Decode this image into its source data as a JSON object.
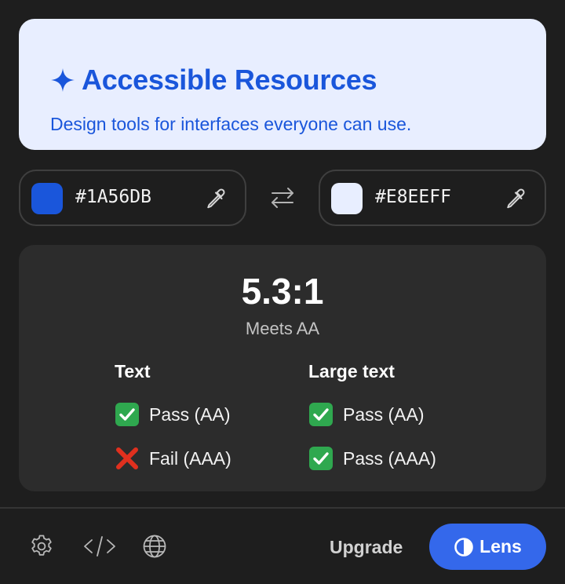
{
  "preview": {
    "title": "Accessible Resources",
    "subtitle": "Design tools for interfaces everyone can use.",
    "icon": "sparkle-icon"
  },
  "foreground": {
    "hex": "#1A56DB",
    "icon": "eyedropper-icon"
  },
  "background": {
    "hex": "#E8EEFF",
    "icon": "eyedropper-icon"
  },
  "swap_icon": "swap-arrows-icon",
  "result": {
    "ratio": "5.3:1",
    "verdict": "Meets AA",
    "text": {
      "heading": "Text",
      "rows": [
        {
          "status": "pass",
          "label": "Pass (AA)"
        },
        {
          "status": "fail",
          "label": "Fail (AAA)"
        }
      ]
    },
    "large_text": {
      "heading": "Large text",
      "rows": [
        {
          "status": "pass",
          "label": "Pass (AA)"
        },
        {
          "status": "pass",
          "label": "Pass (AAA)"
        }
      ]
    }
  },
  "footer": {
    "icons": [
      "gear-icon",
      "code-icon",
      "globe-icon"
    ],
    "upgrade_label": "Upgrade",
    "lens_label": "Lens"
  },
  "colors": {
    "app_background": "#1e1e1e",
    "card_background": "#2c2c2c",
    "accent": "#3468eb",
    "pass": "#2fa84f",
    "fail": "#e0301e"
  }
}
